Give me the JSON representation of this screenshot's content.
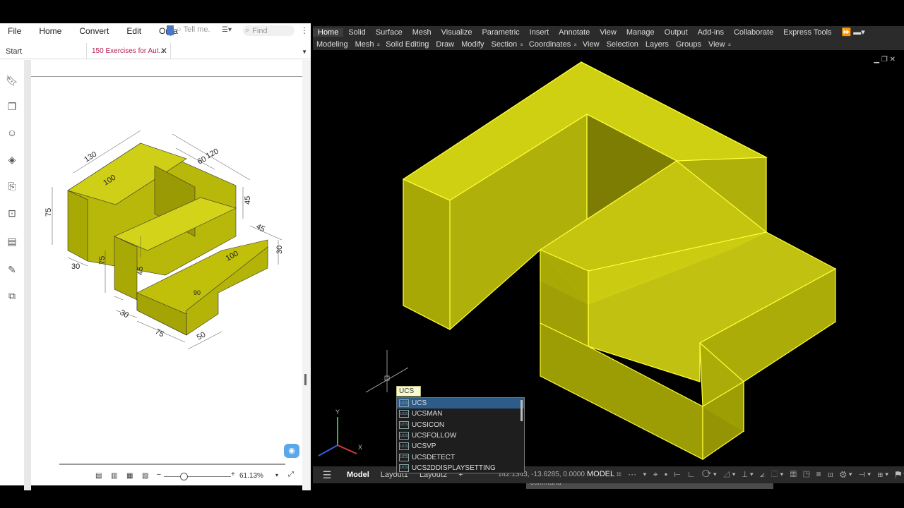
{
  "pdf": {
    "menu": [
      "File",
      "Home",
      "Convert",
      "Edit",
      "Orga"
    ],
    "tell_me": "Tell me.",
    "find": "Find",
    "tabs": {
      "start": "Start",
      "doc": "150 Exercises for Aut..."
    },
    "zoom": "61.13%",
    "drawing_dims": {
      "d130": "130",
      "d120": "120",
      "d60": "60",
      "d100a": "100",
      "d75a": "75",
      "d45a": "45",
      "d45b": "45",
      "d30a": "30",
      "d100b": "100",
      "d30b": "30",
      "d75b": "75",
      "d45c": "45",
      "d90": "90",
      "d30c": "30",
      "d75c": "75",
      "d50": "50"
    }
  },
  "cad": {
    "ribbon_tabs": [
      "Home",
      "Solid",
      "Surface",
      "Mesh",
      "Visualize",
      "Parametric",
      "Insert",
      "Annotate",
      "View",
      "Manage",
      "Output",
      "Add-ins",
      "Collaborate",
      "Express Tools"
    ],
    "panels": [
      "Modeling",
      "Mesh",
      "Solid Editing",
      "Draw",
      "Modify",
      "Section",
      "Coordinates",
      "View",
      "Selection",
      "Layers",
      "Groups",
      "View"
    ],
    "autocomplete_tip": "UCS",
    "autocomplete": [
      "UCS",
      "UCSMAN",
      "UCSICON",
      "UCSFOLLOW",
      "UCSVP",
      "UCSDETECT",
      "UCS2DDISPLAYSETTING"
    ],
    "command_placeholder": "command",
    "layout_tabs": [
      "Model",
      "Layout1",
      "Layout2"
    ],
    "coords": "142.1343, -13.6285, 0.0000",
    "model_label": "MODEL",
    "colors": {
      "solid": "#c2c20a",
      "edge": "#ffff3a",
      "selection": "#2d5c8a"
    }
  }
}
